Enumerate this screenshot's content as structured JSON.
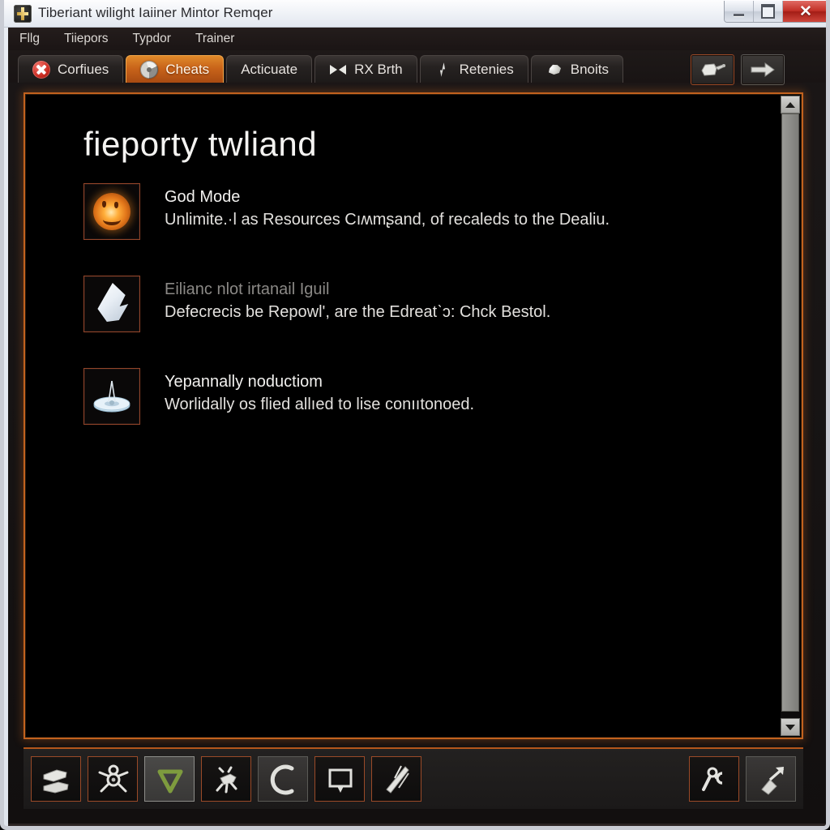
{
  "window": {
    "title": "Tiberiant wilight Iaiiner Mintor Remqer",
    "icon": "app-icon",
    "controls": {
      "minimize": "minimize-button",
      "maximize": "maximize-button",
      "close_label": "✕"
    }
  },
  "menubar": {
    "items": [
      {
        "label": "Fllg"
      },
      {
        "label": "Tiiepors"
      },
      {
        "label": "Typdor"
      },
      {
        "label": "Trainer"
      }
    ]
  },
  "tabs": [
    {
      "label": "Corfiues",
      "icon": "red-x-icon",
      "active": false
    },
    {
      "label": "Cheats",
      "icon": "disc-icon",
      "active": true
    },
    {
      "label": "Acticuate",
      "icon": "none",
      "active": false
    },
    {
      "label": "RX Brth",
      "icon": "bowtie-icon",
      "active": false
    },
    {
      "label": "Retenies",
      "icon": "bolt-icon",
      "active": false
    },
    {
      "label": "Bnoits",
      "icon": "rock-icon",
      "active": false
    }
  ],
  "top_tools": [
    {
      "name": "pour-tool-button",
      "icon": "watering-can-icon"
    },
    {
      "name": "forward-arrow-button",
      "icon": "arrow-right-icon"
    }
  ],
  "content": {
    "heading": "fieporty twliand",
    "items": [
      {
        "title": "God Mode",
        "title_dim": false,
        "description": "Unlimite.·l as Resources Cıʍmʂand, of recaleds to the Dealiu.",
        "icon": "glowing-sphere-icon"
      },
      {
        "title": "Eilianc nlot irtanail Iguil",
        "title_dim": true,
        "description": "Defecrecis be Repowl', are the Edreatˋɔ: Chck Bestol.",
        "icon": "crystal-shard-icon"
      },
      {
        "title": "Yepannally noductiom",
        "title_dim": false,
        "description": "Worlidally os flied allıed to lise conııtonoed.",
        "icon": "landing-pad-icon"
      }
    ]
  },
  "scrollbar": {
    "up_label": "▲",
    "down_label": "▼"
  },
  "bottom_tools": {
    "left": [
      {
        "name": "bricks-tool-button",
        "icon": "blocks-icon",
        "state": "normal"
      },
      {
        "name": "turret-tool-button",
        "icon": "spider-turret-icon",
        "state": "normal"
      },
      {
        "name": "shield-tool-button",
        "icon": "green-shield-icon",
        "state": "selected"
      },
      {
        "name": "mech-tool-button",
        "icon": "walker-icon",
        "state": "normal"
      },
      {
        "name": "crescent-tool-button",
        "icon": "crescent-icon",
        "state": "plain"
      },
      {
        "name": "screen-tool-button",
        "icon": "monitor-icon",
        "state": "normal"
      },
      {
        "name": "blade-tool-button",
        "icon": "blade-icon",
        "state": "normal"
      }
    ],
    "right": [
      {
        "name": "wrench-tool-button",
        "icon": "wrench-hook-icon",
        "state": "normal"
      },
      {
        "name": "expand-tool-button",
        "icon": "arrow-expand-icon",
        "state": "plain"
      }
    ]
  },
  "colors": {
    "accent": "#c2621e",
    "panel_bg": "#000000",
    "tab_active": "#c9641a",
    "icon_border": "#94452a"
  }
}
